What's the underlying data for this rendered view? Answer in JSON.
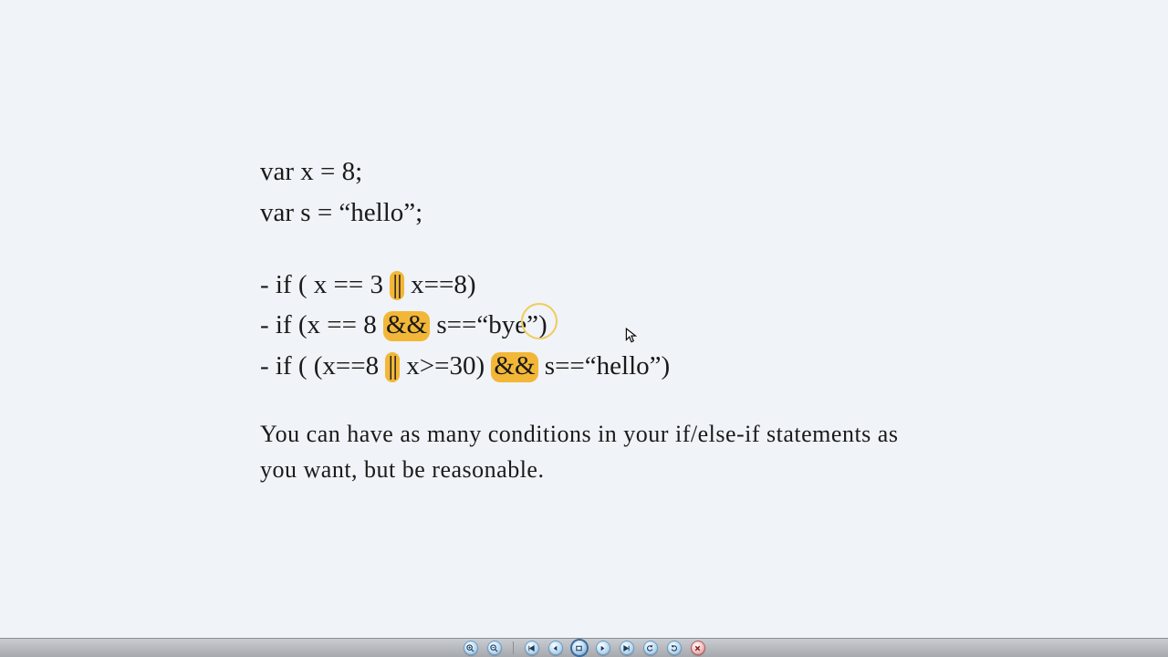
{
  "slide": {
    "code": {
      "l1": "var x = 8;",
      "l2": "var s = “hello”;",
      "l3_a": "- if ( x == 3 ",
      "l3_op": "||",
      "l3_b": " x==8)",
      "l4_a": "- if (x == 8 ",
      "l4_op": "&&",
      "l4_b": " s==“bye",
      "l4_c": "”",
      "l4_d": ")",
      "l5_a": "- if ( (x==8 ",
      "l5_op1": "||",
      "l5_b": " x>=30) ",
      "l5_op2": "&&",
      "l5_c": " s==“hello”)"
    },
    "note": "You can have as many conditions in your if/else-if statements as you want, but be reasonable."
  },
  "toolbar": {
    "zoom_in": "zoom-in",
    "zoom_out": "zoom-out",
    "first": "first-slide",
    "prev": "previous-slide",
    "current": "current-slide",
    "next": "next-slide",
    "undo": "undo",
    "redo": "redo",
    "close": "close"
  }
}
